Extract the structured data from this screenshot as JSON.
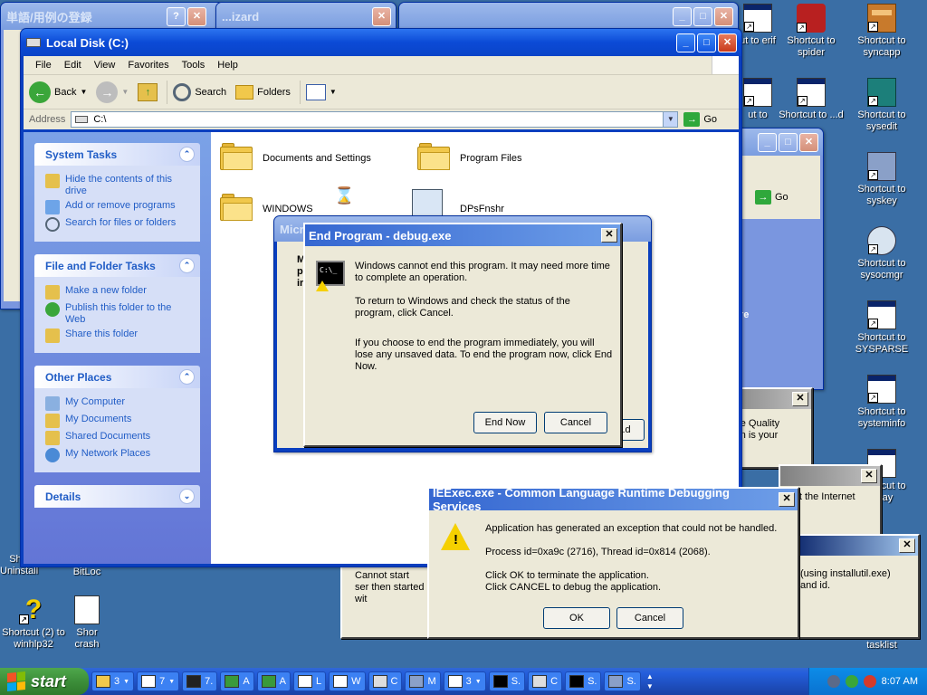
{
  "desktop": {
    "icons": [
      {
        "label": "ut to erif"
      },
      {
        "label": "Shortcut to spider"
      },
      {
        "label": "Shortcut to syncapp"
      },
      {
        "label": "ut to"
      },
      {
        "label": "Shortcut to ...d"
      },
      {
        "label": "Shortcut to sysedit"
      },
      {
        "label": "Shortcut to syskey"
      },
      {
        "label": "Shortcut to sysocmgr"
      },
      {
        "label": "Shortcut to SYSPARSE"
      },
      {
        "label": "Shortcut to systeminfo"
      },
      {
        "label": "Shortcut to ...ray"
      },
      {
        "label": "tasklist"
      },
      {
        "label": "Shortcut (2) to winhlp32"
      },
      {
        "label": "Shor crash"
      },
      {
        "label": "Sho Uninstall"
      },
      {
        "label": "BitLoc"
      }
    ]
  },
  "bg_windows": {
    "jp_title": "単語/用例の登録",
    "wizard_title": "...izard",
    "micro_title": "Micr",
    "micro_text": "M p ir",
    "micro_btn": "...d",
    "right_text1": "re",
    "right_text2": "ware Quality ation is your",
    "right_text3": "tart the Internet",
    "right_text4": "(using installutil.exe) and id.",
    "cannot_start": "Cannot start ser then started wit",
    "go_label": "Go"
  },
  "explorer": {
    "title": "Local Disk (C:)",
    "menu": [
      "File",
      "Edit",
      "View",
      "Favorites",
      "Tools",
      "Help"
    ],
    "toolbar": {
      "back": "Back",
      "search": "Search",
      "folders": "Folders"
    },
    "address_label": "Address",
    "address_value": "C:\\",
    "go": "Go",
    "system_tasks": {
      "title": "System Tasks",
      "items": [
        "Hide the contents of this drive",
        "Add or remove programs",
        "Search for files or folders"
      ]
    },
    "file_tasks": {
      "title": "File and Folder Tasks",
      "items": [
        "Make a new folder",
        "Publish this folder to the Web",
        "Share this folder"
      ]
    },
    "other_places": {
      "title": "Other Places",
      "items": [
        "My Computer",
        "My Documents",
        "Shared Documents",
        "My Network Places"
      ]
    },
    "details": {
      "title": "Details"
    },
    "files": [
      {
        "name": "Documents and Settings"
      },
      {
        "name": "Program Files"
      },
      {
        "name": "WINDOWS"
      },
      {
        "name": "DPsFnshr"
      }
    ]
  },
  "end_program": {
    "title": "End Program - debug.exe",
    "line1": "Windows cannot end this program. It may need more time to complete an operation.",
    "line2": "To return to Windows and check the status of the program, click Cancel.",
    "line3": "If you choose to end the program immediately, you will lose any unsaved data. To end the program now, click End Now.",
    "end_now": "End Now",
    "cancel": "Cancel"
  },
  "ieexec": {
    "title": "IEExec.exe - Common Language Runtime Debugging Services",
    "line1": "Application has generated an exception that could not be handled.",
    "line2": "Process id=0xa9c (2716), Thread id=0x814 (2068).",
    "line3": "Click OK to terminate the application.",
    "line4": "Click CANCEL to debug the application.",
    "ok": "OK",
    "cancel": "Cancel"
  },
  "taskbar": {
    "start": "start",
    "items": [
      "3",
      "7",
      "7.",
      "A",
      "A",
      "L",
      "W",
      "C",
      "M",
      "3",
      "S.",
      "C",
      "S.",
      "S."
    ],
    "clock": "8:07 AM"
  },
  "colors": {
    "xp_blue": "#0a3fbf",
    "desktop": "#3a6ea5",
    "taskpane": "#7ba2e7"
  }
}
